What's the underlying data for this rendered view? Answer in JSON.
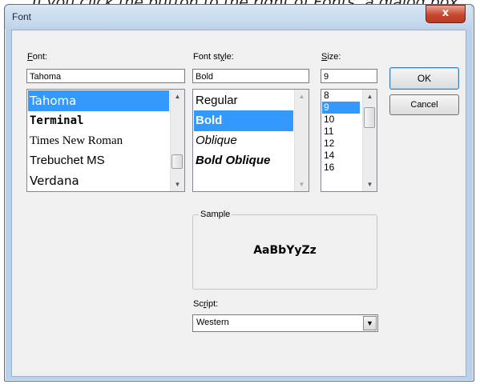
{
  "caption": "If you click the button to the right of Fonts, a dialog box",
  "window": {
    "title": "Font",
    "close_glyph": "x"
  },
  "font": {
    "label_accel": "F",
    "label_rest": "ont:",
    "value": "Tahoma",
    "items": [
      {
        "label": "Tahoma",
        "selected": true
      },
      {
        "label": "Terminal",
        "selected": false
      },
      {
        "label": "Times New Roman",
        "selected": false
      },
      {
        "label": "Trebuchet MS",
        "selected": false
      },
      {
        "label": "Verdana",
        "selected": false
      }
    ]
  },
  "style": {
    "label_pre": "Font st",
    "label_accel": "y",
    "label_rest": "le:",
    "value": "Bold",
    "items": [
      {
        "label": "Regular",
        "selected": false
      },
      {
        "label": "Bold",
        "selected": true
      },
      {
        "label": "Oblique",
        "selected": false
      },
      {
        "label": "Bold Oblique",
        "selected": false
      }
    ]
  },
  "size": {
    "label_accel": "S",
    "label_rest": "ize:",
    "value": "9",
    "items": [
      {
        "label": "8",
        "selected": false
      },
      {
        "label": "9",
        "selected": true
      },
      {
        "label": "10",
        "selected": false
      },
      {
        "label": "11",
        "selected": false
      },
      {
        "label": "12",
        "selected": false
      },
      {
        "label": "14",
        "selected": false
      },
      {
        "label": "16",
        "selected": false
      }
    ]
  },
  "buttons": {
    "ok": "OK",
    "cancel": "Cancel"
  },
  "sample": {
    "legend": "Sample",
    "text": "AaBbYyZz"
  },
  "script": {
    "label_pre": "Sc",
    "label_accel": "r",
    "label_rest": "ipt:",
    "value": "Western"
  },
  "icons": {
    "up": "scroll-up-arrow",
    "down": "scroll-down-arrow",
    "dropdown": "chevron-down"
  },
  "colors": {
    "selection": "#3399ff",
    "title_bar": "#bed3ea",
    "close_button": "#c7482f",
    "dialog_bg": "#f0f0f0"
  }
}
